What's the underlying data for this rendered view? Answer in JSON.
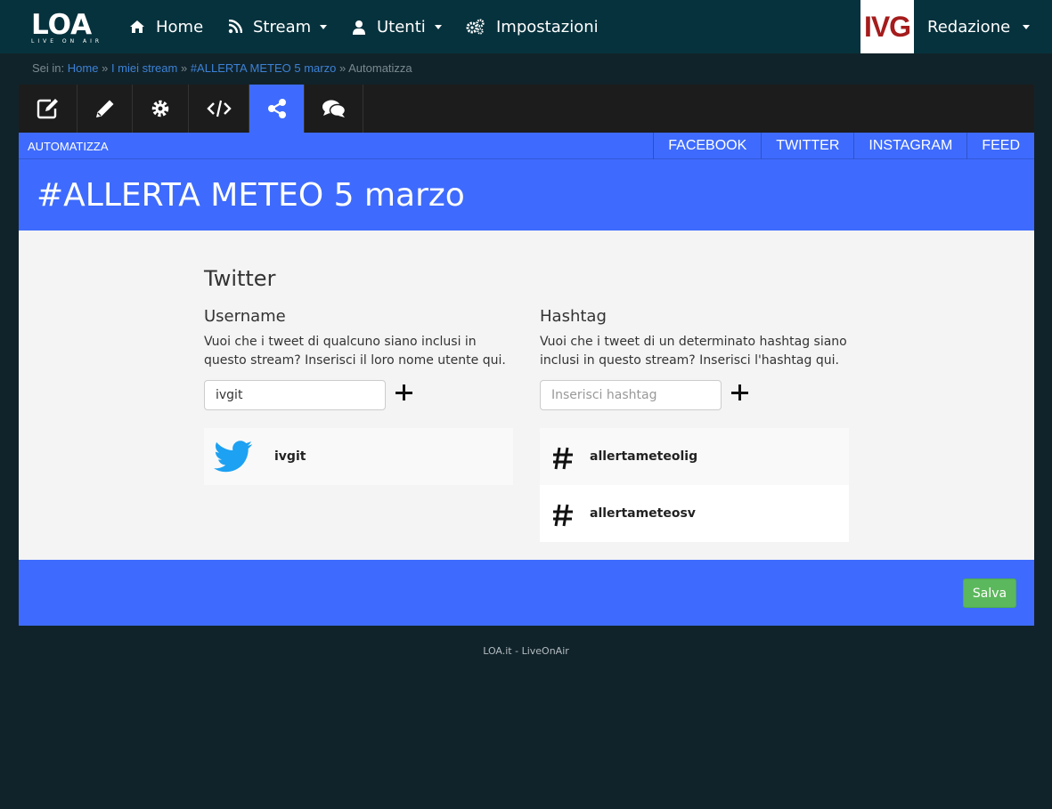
{
  "navbar": {
    "logo_text": "LOA",
    "logo_tagline": "LIVE ON AIR",
    "items": [
      {
        "label": "Home",
        "icon": "home-icon"
      },
      {
        "label": "Stream",
        "icon": "rss-icon"
      },
      {
        "label": "Utenti",
        "icon": "user-icon"
      },
      {
        "label": "Impostazioni",
        "icon": "gears-icon"
      }
    ],
    "brand_badge": "IVG",
    "account_label": "Redazione"
  },
  "breadcrumb": {
    "prefix": "Sei in:",
    "items": [
      "Home",
      "I miei stream",
      "#ALLERTA METEO 5 marzo",
      "Automatizza"
    ],
    "separator": "»"
  },
  "toolbar": {
    "tools": [
      {
        "icon": "edit-square-icon"
      },
      {
        "icon": "pencil-icon"
      },
      {
        "icon": "gear-icon"
      },
      {
        "icon": "code-icon"
      },
      {
        "icon": "share-icon",
        "active": true
      },
      {
        "icon": "comments-icon"
      }
    ]
  },
  "subnav": {
    "label": "AUTOMATIZZA",
    "links": [
      "FACEBOOK",
      "TWITTER",
      "INSTAGRAM",
      "FEED"
    ]
  },
  "page_title": "#ALLERTA METEO 5 marzo",
  "twitter_section": {
    "title": "Twitter",
    "username": {
      "heading": "Username",
      "description": "Vuoi che i tweet di qualcuno siano inclusi in questo stream? Inserisci il loro nome utente qui.",
      "input_value": "ivgit",
      "items": [
        "ivgit"
      ]
    },
    "hashtag": {
      "heading": "Hashtag",
      "description": "Vuoi che i tweet di un determinato hashtag siano inclusi in questo stream? Inserisci l'hashtag qui.",
      "placeholder": "Inserisci hashtag",
      "items": [
        "allertameteolig",
        "allertameteosv"
      ]
    }
  },
  "save_label": "Salva",
  "footer": "LOA.it - LiveOnAir",
  "colors": {
    "navbar": "#06323d",
    "accent": "#3e6bfd",
    "page_bg": "#11232a",
    "save_green": "#5cb85c",
    "twitter_blue": "#1da1f2"
  }
}
